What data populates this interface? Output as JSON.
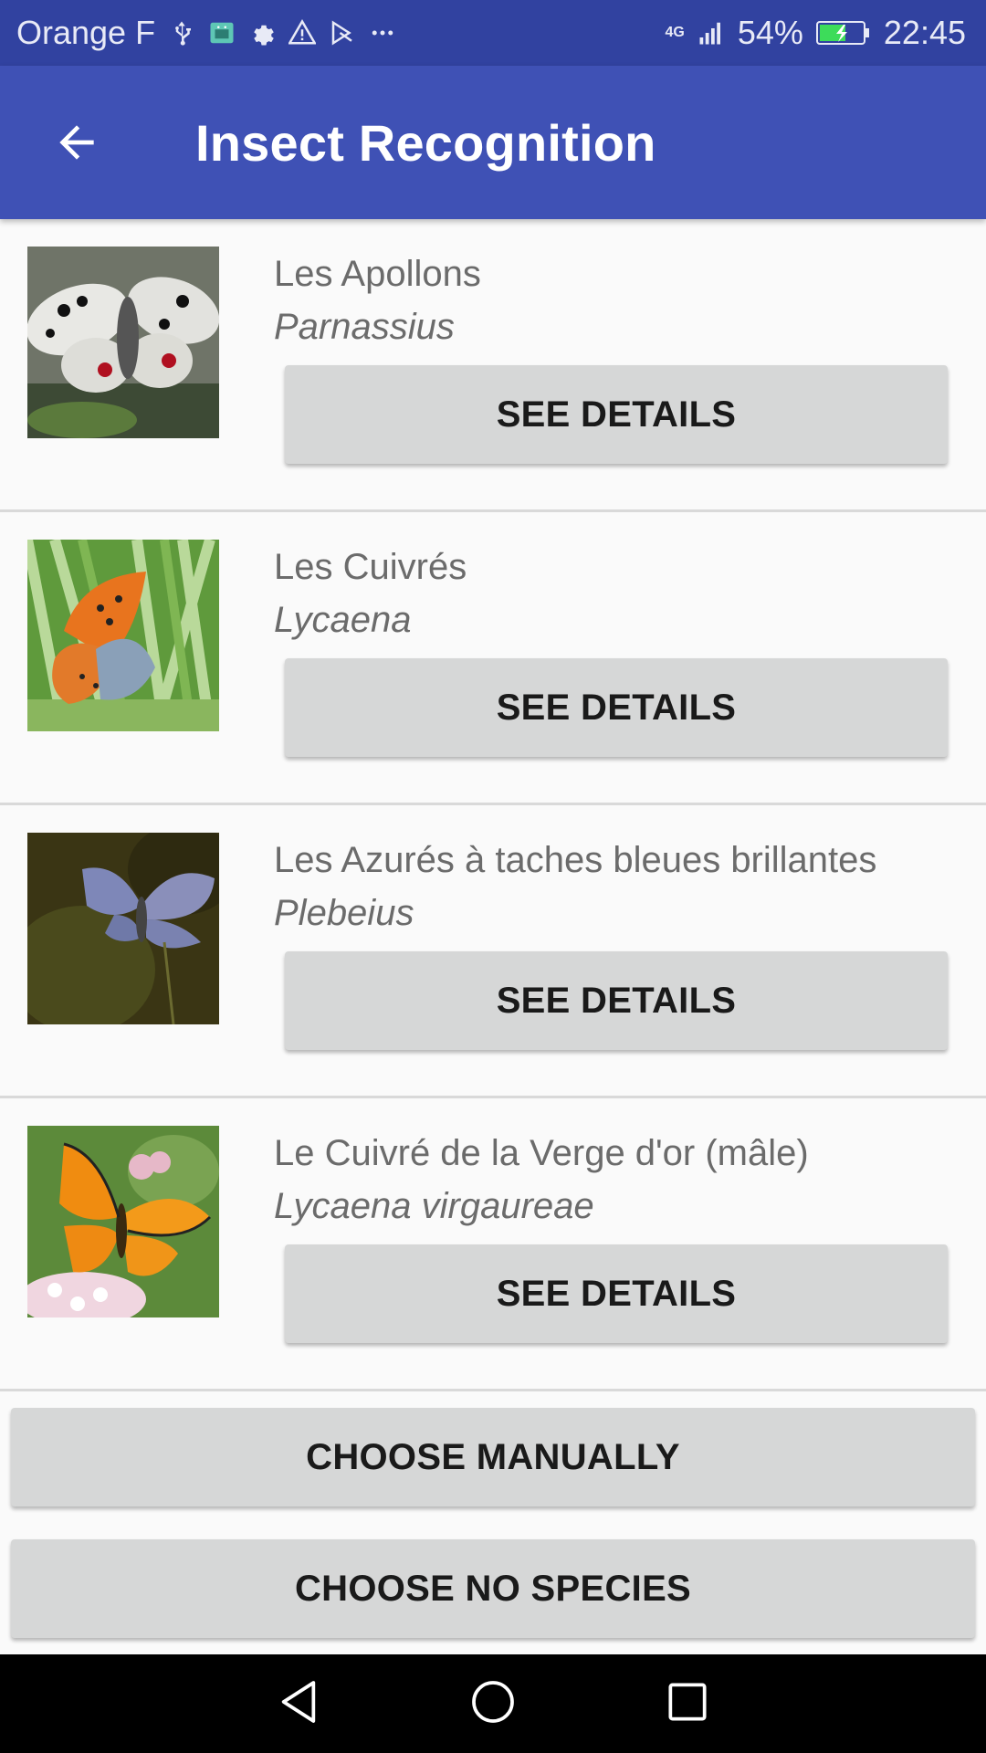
{
  "status_bar": {
    "carrier": "Orange F",
    "left_icons": [
      "usb-icon",
      "android-debug-icon",
      "settings-icon",
      "warning-icon",
      "play-store-icon",
      "more-dots-icon"
    ],
    "network": "4G",
    "battery": "54%",
    "time": "22:45"
  },
  "app_bar": {
    "title": "Insect Recognition",
    "back_icon": "arrow-back-icon"
  },
  "results": [
    {
      "common_name": "Les Apollons",
      "latin_name": "Parnassius",
      "button": "SEE DETAILS"
    },
    {
      "common_name": "Les Cuivrés",
      "latin_name": "Lycaena",
      "button": "SEE DETAILS"
    },
    {
      "common_name": "Les Azurés à taches bleues brillantes",
      "latin_name": "Plebeius",
      "button": "SEE DETAILS"
    },
    {
      "common_name": "Le Cuivré de la Verge d'or (mâle)",
      "latin_name": "Lycaena virgaureae",
      "button": "SEE DETAILS"
    }
  ],
  "actions": {
    "choose_manually": "CHOOSE MANUALLY",
    "choose_no_species": "CHOOSE NO SPECIES"
  },
  "nav_bar": {
    "icons": [
      "back-triangle-icon",
      "home-circle-icon",
      "recents-square-icon"
    ]
  },
  "colors": {
    "status_bar": "#3142a0",
    "app_bar": "#3f51b5",
    "button": "#d6d7d7",
    "background": "#fafafa"
  }
}
